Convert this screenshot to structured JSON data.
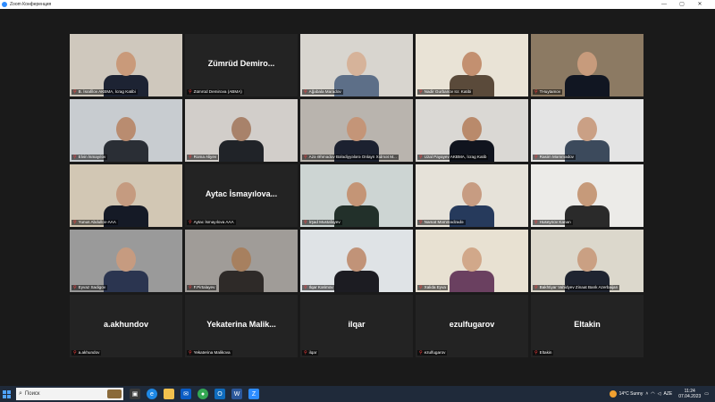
{
  "window": {
    "title": "Zoom Конференция"
  },
  "participants": [
    {
      "label": "B. İsrafilov AKBMA, İcrag Katibi",
      "active": false,
      "video": true
    },
    {
      "label": "Zümrüd Demirova (ABMA)",
      "active": false,
      "video": false,
      "display_name": "Zümrüd Demiro..."
    },
    {
      "label": "Ağabala Maradov",
      "active": false,
      "video": true
    },
    {
      "label": "Nadir Gurbanov Icr. Katibi",
      "active": false,
      "video": true
    },
    {
      "label": "THuytamov",
      "active": false,
      "video": true
    },
    {
      "label": "Elvin İsmayılov",
      "active": false,
      "video": true
    },
    {
      "label": "Roma Aliyev",
      "active": false,
      "video": true
    },
    {
      "label": "Azə Əhmədov Bələdiyyələrə Onlayn Xidmət M...",
      "active": false,
      "video": true
    },
    {
      "label": "Uzal Payayev AKBMA, İcrag Katib",
      "active": false,
      "video": true
    },
    {
      "label": "Rasim Məmmədov",
      "active": false,
      "video": true
    },
    {
      "label": "Yunus Abdullov-AAA",
      "active": true,
      "video": true
    },
    {
      "label": "Aytac İsmayılova AAA",
      "active": false,
      "video": false,
      "display_name": "Aytac İsmayılova..."
    },
    {
      "label": "İrşad Mustafayev",
      "active": false,
      "video": true
    },
    {
      "label": "Namat Məmmədzadə",
      "active": false,
      "video": true
    },
    {
      "label": "Huseynov Kanan",
      "active": false,
      "video": true
    },
    {
      "label": "Eyvaz Sadigov",
      "active": false,
      "video": true
    },
    {
      "label": "F.Pirtalayev",
      "active": false,
      "video": true
    },
    {
      "label": "Ilqar Kərimov",
      "active": false,
      "video": true
    },
    {
      "label": "Xalida Eyva",
      "active": false,
      "video": true
    },
    {
      "label": "Bakhtiyar Vahidyev Zinaat Bank Azerbaijan",
      "active": false,
      "video": true
    },
    {
      "label": "a.akhundov",
      "active": false,
      "video": false,
      "display_name": "a.akhundov"
    },
    {
      "label": "Yekaterina Malikova",
      "active": false,
      "video": false,
      "display_name": "Yekaterina Malik..."
    },
    {
      "label": "ilqar",
      "active": false,
      "video": false,
      "display_name": "ilqar"
    },
    {
      "label": "ezulfugarov",
      "active": false,
      "video": false,
      "display_name": "ezulfugarov"
    },
    {
      "label": "Eltakin",
      "active": false,
      "video": false,
      "display_name": "Eltakin"
    }
  ],
  "taskbar": {
    "search_placeholder": "Поиск",
    "weather": "14°C  Sunny",
    "lang": "AZE",
    "time": "11:24",
    "date": "07.04.2023"
  },
  "colors": {
    "active_outline": "#e6e85c",
    "tile_bg": "#232323",
    "taskbar_bg": "#1f2a3a"
  },
  "scenes": [
    {
      "bg": "#cfc8bd",
      "body": "#1d2333",
      "skin": "#c99a7a"
    },
    null,
    {
      "bg": "#d8d5cf",
      "body": "#5d6f88",
      "skin": "#d6b39a"
    },
    {
      "bg": "#e9e3d6",
      "body": "#5a4a3a",
      "skin": "#c39070"
    },
    {
      "bg": "#8c7a63",
      "body": "#111622",
      "skin": "#c79b7c"
    },
    {
      "bg": "#c8ccd0",
      "body": "#2a2e35",
      "skin": "#b98c70"
    },
    {
      "bg": "#d2ceca",
      "body": "#202328",
      "skin": "#a8826a"
    },
    {
      "bg": "#b9b4ae",
      "body": "#1c2130",
      "skin": "#c49578"
    },
    {
      "bg": "#dad8d4",
      "body": "#10141e",
      "skin": "#b98a6b"
    },
    {
      "bg": "#e4e4e4",
      "body": "#3c4a5c",
      "skin": "#caa085"
    },
    {
      "bg": "#d2c7b4",
      "body": "#151a26",
      "skin": "#c59b80"
    },
    null,
    {
      "bg": "#cdd5d3",
      "body": "#22302a",
      "skin": "#c49576"
    },
    {
      "bg": "#e6e2d9",
      "body": "#263a5c",
      "skin": "#c79c82"
    },
    {
      "bg": "#ecebe8",
      "body": "#2a2a2a",
      "skin": "#c69a7a"
    },
    {
      "bg": "#9a9a9a",
      "body": "#2b3550",
      "skin": "#c69b80"
    },
    {
      "bg": "#a09c98",
      "body": "#2e2a28",
      "skin": "#a7805f"
    },
    {
      "bg": "#dfe3e6",
      "body": "#1c1c22",
      "skin": "#c19378"
    },
    {
      "bg": "#e8e1d2",
      "body": "#6a4060",
      "skin": "#d1a88a"
    },
    {
      "bg": "#dcd8cc",
      "body": "#1f2430",
      "skin": "#caa083"
    },
    null,
    null,
    null,
    null,
    null
  ]
}
